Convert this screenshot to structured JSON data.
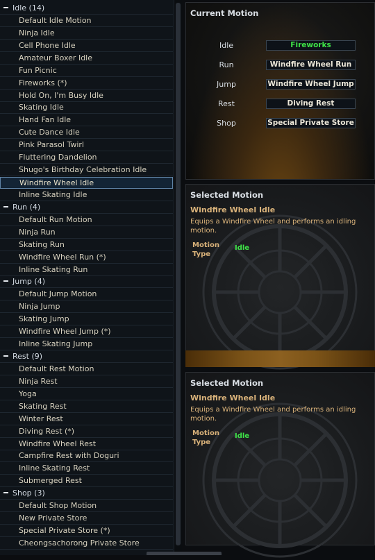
{
  "motion_list": {
    "groups": [
      {
        "label": "Idle (14)",
        "items": [
          "Default Idle Motion",
          "Ninja Idle",
          "Cell Phone Idle",
          "Amateur Boxer Idle",
          "Fun Picnic",
          "Fireworks (*)",
          "Hold On, I'm Busy Idle",
          "Skating Idle",
          "Hand Fan Idle",
          "Cute Dance Idle",
          "Pink Parasol Twirl",
          "Fluttering Dandelion",
          "Shugo's Birthday Celebration Idle",
          "Windfire Wheel Idle",
          "Inline Skating Idle"
        ]
      },
      {
        "label": "Run (4)",
        "items": [
          "Default Run Motion",
          "Ninja Run",
          "Skating Run",
          "Windfire Wheel Run (*)",
          "Inline Skating Run"
        ]
      },
      {
        "label": "Jump (4)",
        "items": [
          "Default Jump Motion",
          "Ninja Jump",
          "Skating Jump",
          "Windfire Wheel Jump (*)",
          "Inline Skating Jump"
        ]
      },
      {
        "label": "Rest (9)",
        "items": [
          "Default Rest Motion",
          "Ninja Rest",
          "Yoga",
          "Skating Rest",
          "Winter Rest",
          "Diving Rest (*)",
          "Windfire Wheel Rest",
          "Campfire Rest with Doguri",
          "Inline Skating Rest",
          "Submerged Rest"
        ]
      },
      {
        "label": "Shop (3)",
        "items": [
          "Default Shop Motion",
          "New Private Store",
          "Special Private Store (*)",
          "Cheongsachorong Private Store"
        ]
      }
    ],
    "selected_item": "Windfire Wheel Idle"
  },
  "current_motion": {
    "title": "Current Motion",
    "rows": [
      {
        "label": "Idle",
        "value": "Fireworks",
        "highlight": true
      },
      {
        "label": "Run",
        "value": "Windfire Wheel Run"
      },
      {
        "label": "Jump",
        "value": "Windfire Wheel Jump"
      },
      {
        "label": "Rest",
        "value": "Diving Rest"
      },
      {
        "label": "Shop",
        "value": "Special Private Store"
      }
    ]
  },
  "selected_panels": [
    {
      "title": "Selected Motion",
      "name": "Windfire Wheel Idle",
      "description": "Equips a Windfire Wheel and performs an idling motion.",
      "type_label": "Motion Type",
      "type_value": "Idle"
    },
    {
      "title": "Selected Motion",
      "name": "Windfire Wheel Idle",
      "description": "Equips a Windfire Wheel and performs an idling motion.",
      "type_label": "Motion Type",
      "type_value": "Idle"
    }
  ],
  "colors": {
    "highlight_green": "#3ee247",
    "gold_text": "#d9b27a",
    "selection_border": "#5f83a6"
  }
}
